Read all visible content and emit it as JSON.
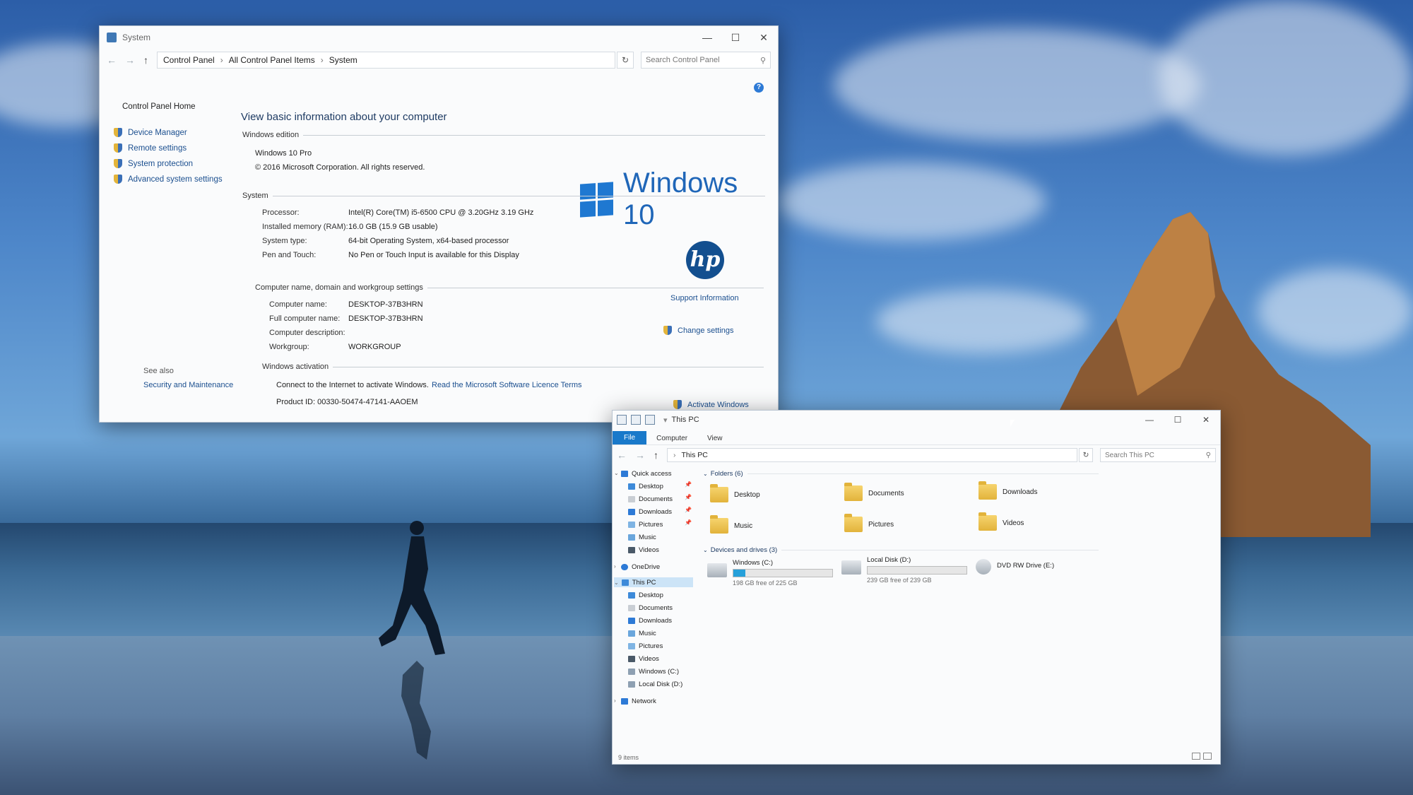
{
  "system_window": {
    "title": "System",
    "controls": {
      "minimize": "—",
      "maximize": "☐",
      "close": "✕"
    },
    "breadcrumb": [
      "Control Panel",
      "All Control Panel Items",
      "System"
    ],
    "search_placeholder": "Search Control Panel",
    "sidebar": {
      "home": "Control Panel Home",
      "items": [
        {
          "label": "Device Manager"
        },
        {
          "label": "Remote settings"
        },
        {
          "label": "System protection"
        },
        {
          "label": "Advanced system settings"
        }
      ],
      "see_also": "See also",
      "see_also_link": "Security and Maintenance"
    },
    "headline": "View basic information about your computer",
    "windows_edition": {
      "section": "Windows edition",
      "edition": "Windows 10 Pro",
      "copyright": "© 2016 Microsoft Corporation. All rights reserved.",
      "logo_text": "Windows 10"
    },
    "system": {
      "section": "System",
      "rows": [
        {
          "label": "Processor:",
          "value": "Intel(R) Core(TM) i5-6500 CPU @ 3.20GHz   3.19 GHz"
        },
        {
          "label": "Installed memory (RAM):",
          "value": "16.0 GB (15.9 GB usable)"
        },
        {
          "label": "System type:",
          "value": "64-bit Operating System, x64-based processor"
        },
        {
          "label": "Pen and Touch:",
          "value": "No Pen or Touch Input is available for this Display"
        }
      ],
      "oem_logo": "hp",
      "support_link": "Support Information"
    },
    "computer_name": {
      "section": "Computer name, domain and workgroup settings",
      "rows": [
        {
          "label": "Computer name:",
          "value": "DESKTOP-37B3HRN"
        },
        {
          "label": "Full computer name:",
          "value": "DESKTOP-37B3HRN"
        },
        {
          "label": "Computer description:",
          "value": ""
        },
        {
          "label": "Workgroup:",
          "value": "WORKGROUP"
        }
      ],
      "change_link": "Change settings"
    },
    "activation": {
      "section": "Windows activation",
      "message": "Connect to the Internet to activate Windows.",
      "licence_link": "Read the Microsoft Software Licence Terms",
      "product_id": "Product ID: 00330-50474-47141-AAOEM",
      "activate_link": "Activate Windows"
    }
  },
  "explorer_window": {
    "title": "This PC",
    "controls": {
      "minimize": "—",
      "maximize": "☐",
      "close": "✕"
    },
    "ribbon_tabs": [
      "File",
      "Computer",
      "View"
    ],
    "address": "This PC",
    "search_placeholder": "Search This PC",
    "nav": {
      "quick_access": "Quick access",
      "quick_items": [
        "Desktop",
        "Documents",
        "Downloads",
        "Pictures",
        "Music",
        "Videos"
      ],
      "onedrive": "OneDrive",
      "this_pc": "This PC",
      "pc_items": [
        "Desktop",
        "Documents",
        "Downloads",
        "Music",
        "Pictures",
        "Videos",
        "Windows (C:)",
        "Local Disk (D:)"
      ],
      "network": "Network"
    },
    "folders_header": "Folders (6)",
    "folders": [
      "Desktop",
      "Documents",
      "Downloads",
      "Music",
      "Pictures",
      "Videos"
    ],
    "drives_header": "Devices and drives (3)",
    "drives": [
      {
        "name": "Windows (C:)",
        "free": "198 GB free of 225 GB",
        "used_fraction": 0.12
      },
      {
        "name": "Local Disk (D:)",
        "free": "239 GB free of 239 GB",
        "used_fraction": 0.0
      },
      {
        "name": "DVD RW Drive (E:)"
      }
    ],
    "status": "9 items"
  },
  "colors": {
    "accent": "#1979ca",
    "link": "#1b4f8f",
    "drive_bar": "#26a0da"
  }
}
